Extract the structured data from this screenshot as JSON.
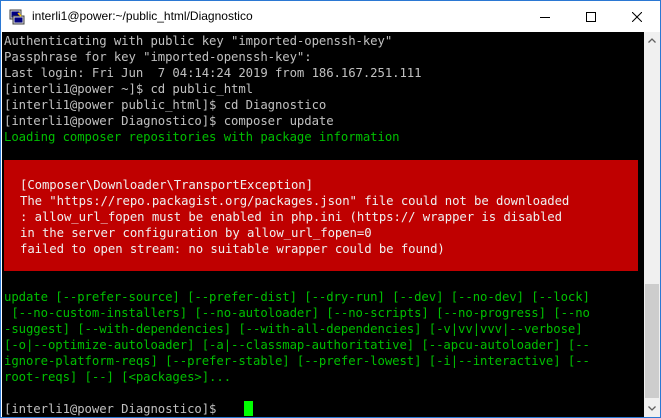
{
  "window": {
    "title": "interli1@power:~/public_html/Diagnostico",
    "minimize_glyph": "—",
    "maximize_glyph": "☐",
    "close_glyph": "✕"
  },
  "colors": {
    "terminal_bg": "#000000",
    "text_white": "#c0c0c0",
    "text_green": "#00bf00",
    "error_bg": "#bf0000",
    "cursor": "#00ff00"
  },
  "terminal": {
    "lines": [
      "Authenticating with public key \"imported-openssh-key\"",
      "Passphrase for key \"imported-openssh-key\":",
      "Last login: Fri Jun  7 04:14:24 2019 from 186.167.251.111",
      "[interli1@power ~]$ cd public_html",
      "[interli1@power public_html]$ cd Diagnostico",
      "[interli1@power Diagnostico]$ composer update",
      "Loading composer repositories with package information"
    ],
    "error": [
      "[Composer\\Downloader\\TransportException]",
      "The \"https://repo.packagist.org/packages.json\" file could not be downloaded",
      ": allow_url_fopen must be enabled in php.ini (https:// wrapper is disabled",
      "in the server configuration by allow_url_fopen=0",
      "failed to open stream: no suitable wrapper could be found)"
    ],
    "usage": [
      "update [--prefer-source] [--prefer-dist] [--dry-run] [--dev] [--no-dev] [--lock]",
      " [--no-custom-installers] [--no-autoloader] [--no-scripts] [--no-progress] [--no",
      "-suggest] [--with-dependencies] [--with-all-dependencies] [-v|vv|vvv|--verbose]",
      "[-o|--optimize-autoloader] [-a|--classmap-authoritative] [--apcu-autoloader] [--",
      "ignore-platform-reqs] [--prefer-stable] [--prefer-lowest] [-i|--interactive] [--",
      "root-reqs] [--] [<packages>]..."
    ],
    "prompt": "[interli1@power Diagnostico]$ "
  }
}
